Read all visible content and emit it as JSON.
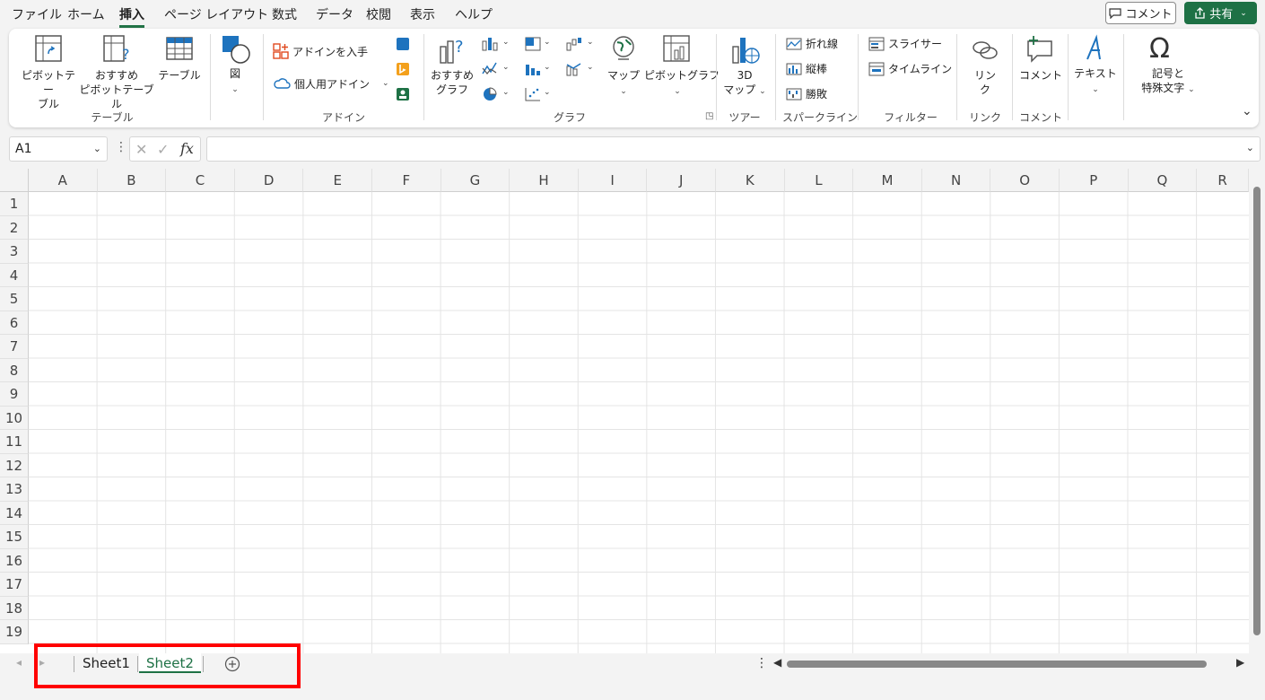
{
  "menu": {
    "tabs": [
      {
        "label": "ファイル",
        "active": false
      },
      {
        "label": "ホーム",
        "active": false
      },
      {
        "label": "挿入",
        "active": true
      },
      {
        "label": "ページ レイアウト",
        "active": false
      },
      {
        "label": "数式",
        "active": false
      },
      {
        "label": "データ",
        "active": false
      },
      {
        "label": "校閲",
        "active": false
      },
      {
        "label": "表示",
        "active": false
      },
      {
        "label": "ヘルプ",
        "active": false
      }
    ],
    "comment_button": "コメント",
    "share_button": "共有"
  },
  "ribbon": {
    "pivot_table": "ピボットテー\nブル",
    "recommended_pivot": "おすすめ\nピボットテーブル",
    "table": "テーブル",
    "group_table": "テーブル",
    "figure": "図",
    "get_addins": "アドインを入手",
    "my_addins": "個人用アドイン",
    "group_addins": "アドイン",
    "recommended_charts": "おすすめ\nグラフ",
    "maps": "マップ",
    "pivot_chart": "ピボットグラフ",
    "group_charts": "グラフ",
    "3d_map": "3D\nマップ",
    "group_tours": "ツアー",
    "line": "折れ線",
    "column": "縦棒",
    "win_loss": "勝敗",
    "group_sparklines": "スパークライン",
    "slicer": "スライサー",
    "timeline": "タイムライン",
    "group_filters": "フィルター",
    "link": "リン\nク",
    "group_links": "リンク",
    "comment": "コメント",
    "group_comments": "コメント",
    "text": "テキスト",
    "symbols": "記号と\n特殊文字"
  },
  "formula_bar": {
    "name_box": "A1",
    "fx_label": "fx",
    "value": ""
  },
  "grid": {
    "columns": [
      "A",
      "B",
      "C",
      "D",
      "E",
      "F",
      "G",
      "H",
      "I",
      "J",
      "K",
      "L",
      "M",
      "N",
      "O",
      "P",
      "Q",
      "R"
    ],
    "rows": [
      "1",
      "2",
      "3",
      "4",
      "5",
      "6",
      "7",
      "8",
      "9",
      "10",
      "11",
      "12",
      "13",
      "14",
      "15",
      "16",
      "17",
      "18",
      "19"
    ]
  },
  "sheets": [
    {
      "label": "Sheet1",
      "active": false
    },
    {
      "label": "Sheet2",
      "active": true
    }
  ],
  "colors": {
    "accent": "#1e7145",
    "highlight": "#ff0000"
  }
}
